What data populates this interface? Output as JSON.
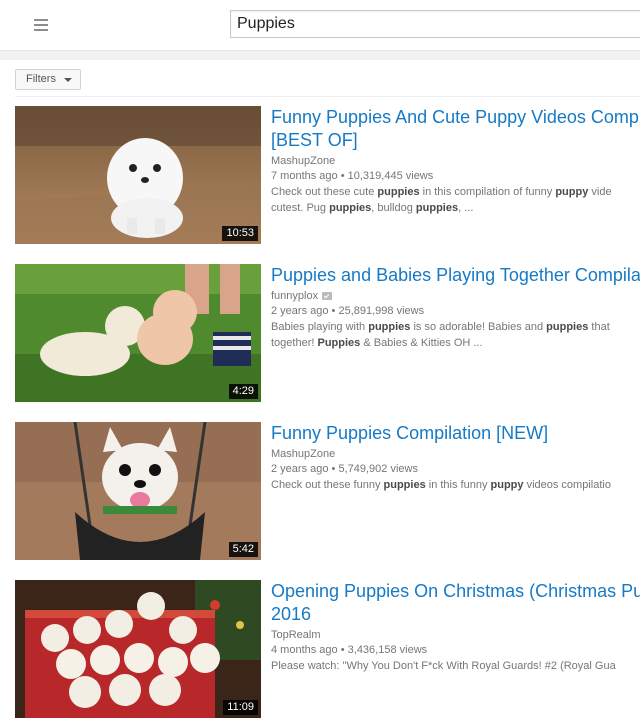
{
  "search": {
    "query": "Puppies"
  },
  "filters": {
    "label": "Filters"
  },
  "results": [
    {
      "title_line1": "Funny Puppies And Cute Puppy Videos Compila",
      "title_line2": "[BEST OF]",
      "channel": "MashupZone",
      "age": "7 months ago",
      "views": "10,319,445 views",
      "desc1": [
        "Check out these cute ",
        "puppies",
        " in this compilation of funny ",
        "puppy",
        " vide"
      ],
      "desc2": [
        "cutest. Pug ",
        "puppies",
        ", bulldog ",
        "puppies",
        ", ..."
      ],
      "duration": "10:53"
    },
    {
      "title_line1": "Puppies and Babies Playing Together Compilat",
      "channel": "funnyplox",
      "age": "2 years ago",
      "views": "25,891,998 views",
      "desc1": [
        "Babies playing with ",
        "puppies",
        " is so adorable! Babies and ",
        "puppies",
        " that"
      ],
      "desc2": [
        "together! ",
        "Puppies",
        " & Babies & Kitties OH ..."
      ],
      "duration": "4:29"
    },
    {
      "title_line1": "Funny Puppies Compilation [NEW]",
      "channel": "MashupZone",
      "age": "2 years ago",
      "views": "5,749,902 views",
      "desc1": [
        "Check out these funny ",
        "puppies",
        " in this funny ",
        "puppy",
        " videos compilatio"
      ],
      "duration": "5:42"
    },
    {
      "title_line1": "Opening Puppies On Christmas (Christmas Pup",
      "title_line2": "2016",
      "channel": "TopRealm",
      "age": "4 months ago",
      "views": "3,436,158 views",
      "desc1": [
        "Please watch: \"Why You Don't F*ck With Royal Guards! #2 (Royal Gua"
      ],
      "duration": "11:09"
    }
  ],
  "meta_separator": "•",
  "icons": {
    "menu": "hamburger-menu-icon",
    "caret": "caret-down-icon",
    "verified": "verified-check-icon"
  },
  "colors": {
    "title": "#167ac6",
    "meta": "#767676"
  }
}
